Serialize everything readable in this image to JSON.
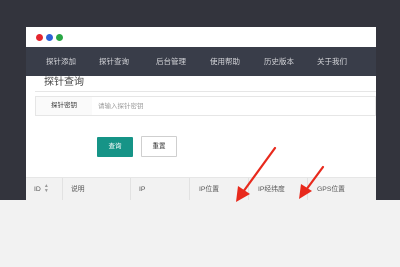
{
  "window": {
    "traffic_lights": [
      "red",
      "blue",
      "green"
    ]
  },
  "nav": {
    "items": [
      "探针添加",
      "探针查询",
      "后台管理",
      "使用帮助",
      "历史版本",
      "关于我们"
    ]
  },
  "page": {
    "title": "探针查询"
  },
  "form": {
    "label": "探针密钥",
    "placeholder": "请输入探针密钥",
    "query_button": "查询",
    "reset_button": "重置"
  },
  "table": {
    "columns": [
      "ID",
      "说明",
      "IP",
      "IP位置",
      "IP经纬度",
      "GPS位置"
    ]
  },
  "colors": {
    "nav_bg": "#393d49",
    "primary": "#169487",
    "annotation_arrow": "#e8291c"
  }
}
